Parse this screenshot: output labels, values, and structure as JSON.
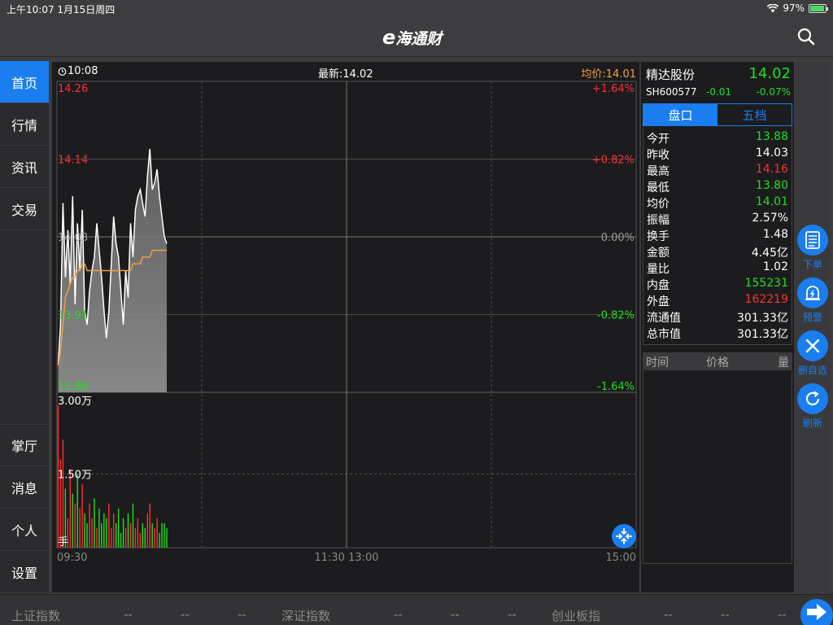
{
  "status_bar": {
    "time_date": "上午10:07   1月15日周四",
    "battery": "97%",
    "battery_level": 0.97
  },
  "header": {
    "logo_prefix": "e",
    "logo_text": "海通财"
  },
  "sidebar": {
    "top_items": [
      {
        "label": "首页",
        "active": true
      },
      {
        "label": "行情"
      },
      {
        "label": "资讯"
      },
      {
        "label": "交易"
      }
    ],
    "bottom_items": [
      {
        "label": "掌厅"
      },
      {
        "label": "消息"
      },
      {
        "label": "个人"
      },
      {
        "label": "设置"
      }
    ]
  },
  "chart_header": {
    "time": "10:08",
    "latest": "最新:14.02",
    "avg": "均价:14.01"
  },
  "chart_data": {
    "type": "line",
    "price_axis_left": [
      "14.26",
      "14.14",
      "14.03",
      "13.91",
      "13.80"
    ],
    "price_axis_right": [
      "+1.64%",
      "+0.82%",
      "0.00%",
      "-0.82%",
      "-1.64%"
    ],
    "ylim": [
      13.8,
      14.26
    ],
    "volume_labels": [
      "3.00万",
      "1.50万",
      "手"
    ],
    "volume_max": 30000,
    "time_labels": [
      "09:30",
      "11:30 13:00",
      "15:00"
    ],
    "total_minutes": 240,
    "series": [
      {
        "name": "最新",
        "color": "#ffffff",
        "values": [
          13.84,
          13.9,
          14.08,
          13.97,
          14.04,
          13.96,
          14.09,
          13.93,
          14.05,
          13.98,
          14.07,
          13.92,
          13.9,
          13.95,
          13.98,
          14.0,
          14.05,
          14.01,
          13.97,
          13.92,
          13.88,
          13.92,
          13.99,
          14.06,
          14.02,
          14.0,
          13.95,
          13.9,
          13.98,
          13.94,
          14.05,
          14.0,
          14.07,
          14.09,
          14.1,
          14.08,
          14.06,
          14.12,
          14.16,
          14.1,
          14.11,
          14.13,
          14.09,
          14.06,
          14.03,
          14.02
        ]
      },
      {
        "name": "均价",
        "color": "#f0a040",
        "values": [
          13.84,
          13.86,
          13.9,
          13.94,
          13.95,
          13.96,
          13.97,
          13.97,
          13.98,
          13.98,
          13.99,
          13.99,
          13.98,
          13.98,
          13.98,
          13.98,
          13.98,
          13.98,
          13.98,
          13.98,
          13.98,
          13.98,
          13.98,
          13.98,
          13.98,
          13.98,
          13.98,
          13.98,
          13.98,
          13.98,
          13.98,
          13.99,
          13.99,
          13.99,
          13.99,
          14.0,
          14.0,
          14.0,
          14.0,
          14.01,
          14.01,
          14.01,
          14.01,
          14.01,
          14.01,
          14.01
        ]
      }
    ],
    "volumes": [
      29000,
      18000,
      22000,
      12000,
      6000,
      16000,
      11000,
      9000,
      15000,
      8000,
      13000,
      7000,
      5000,
      9000,
      6000,
      10000,
      4000,
      8000,
      5000,
      7000,
      6000,
      9000,
      4000,
      7000,
      5000,
      8000,
      3000,
      6000,
      4000,
      7000,
      5000,
      9000,
      4000,
      6000,
      3000,
      5000,
      4000,
      7000,
      9000,
      5000,
      4000,
      6000,
      3000,
      5000,
      5000,
      4000
    ],
    "volume_up": [
      true,
      true,
      true,
      false,
      true,
      true,
      false,
      true,
      false,
      true,
      true,
      false,
      false,
      true,
      true,
      false,
      true,
      false,
      false,
      false,
      false,
      true,
      true,
      true,
      false,
      false,
      false,
      false,
      true,
      false,
      true,
      false,
      true,
      true,
      true,
      false,
      false,
      true,
      true,
      false,
      true,
      true,
      false,
      false,
      false,
      false
    ]
  },
  "quote": {
    "name": "精达股份",
    "price": "14.02",
    "code": "SH600577",
    "change": "-0.01",
    "change_pct": "-0.07%",
    "tabs": [
      {
        "label": "盘口",
        "active": true
      },
      {
        "label": "五档"
      }
    ],
    "stats": [
      {
        "label": "今开",
        "value": "13.88",
        "color": "#1fe01f"
      },
      {
        "label": "昨收",
        "value": "14.03",
        "color": "#ffffff"
      },
      {
        "label": "最高",
        "value": "14.16",
        "color": "#ff3030"
      },
      {
        "label": "最低",
        "value": "13.80",
        "color": "#1fe01f"
      },
      {
        "label": "均价",
        "value": "14.01",
        "color": "#1fe01f"
      },
      {
        "label": "振幅",
        "value": "2.57%",
        "color": "#ffffff"
      },
      {
        "label": "换手",
        "value": "1.48",
        "color": "#ffffff"
      },
      {
        "label": "金额",
        "value": "4.45亿",
        "color": "#ffffff"
      },
      {
        "label": "量比",
        "value": "1.02",
        "color": "#ffffff"
      },
      {
        "label": "内盘",
        "value": "155231",
        "color": "#1fe01f"
      },
      {
        "label": "外盘",
        "value": "162219",
        "color": "#ff3030"
      },
      {
        "label": "流通值",
        "value": "301.33亿",
        "color": "#ffffff"
      },
      {
        "label": "总市值",
        "value": "301.33亿",
        "color": "#ffffff"
      }
    ],
    "ticks_header": {
      "time": "时间",
      "price": "价格",
      "volume": "量"
    }
  },
  "tools": [
    {
      "label": "下单",
      "icon": "document-icon"
    },
    {
      "label": "预警",
      "icon": "alarm-bell-icon"
    },
    {
      "label": "删自选",
      "icon": "close-icon"
    },
    {
      "label": "刷新",
      "icon": "refresh-icon"
    }
  ],
  "bottom_bar": {
    "indices": [
      {
        "name": "上证指数",
        "v1": "--",
        "v2": "--",
        "v3": "--"
      },
      {
        "name": "深证指数",
        "v1": "--",
        "v2": "--",
        "v3": "--"
      },
      {
        "name": "创业板指",
        "v1": "--",
        "v2": "--",
        "v3": "--"
      }
    ]
  },
  "colors": {
    "accent": "#1a7ef0",
    "up": "#ff3030",
    "down": "#1fe01f",
    "avg_line": "#f0a040"
  }
}
